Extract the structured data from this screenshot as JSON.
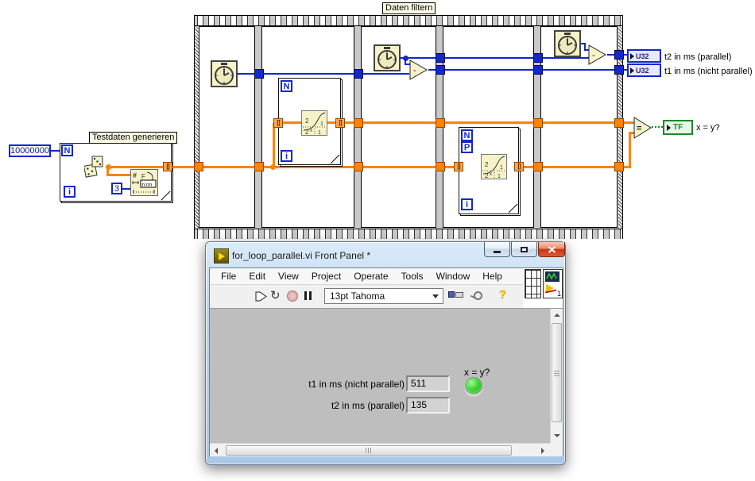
{
  "diagram": {
    "sequence_label": "Daten filtern",
    "loop1_label": "Testdaten generieren",
    "const_iterations": "10000000",
    "const_three": "3",
    "terminal_n": "N",
    "terminal_i": "i",
    "terminal_p": "P",
    "tunnel_brackets": "[]",
    "format_icon": {
      "hash": "#",
      "f": "F",
      "nnn": "n.nn"
    },
    "pow_icon": {
      "two": "2",
      "one_right": "1",
      "exp_base": "2",
      "exp_x": "x",
      "one_bottom": "1"
    },
    "subtract_glyph": "-",
    "equals_glyph": "=",
    "u32_text": "U32",
    "tf_text": "TF",
    "t2_label": "t2 in ms (parallel)",
    "t1_label": "t1 in ms (nicht parallel)",
    "xy_label": "x = y?"
  },
  "window": {
    "title": "for_loop_parallel.vi Front Panel *",
    "menu_items": [
      "File",
      "Edit",
      "View",
      "Project",
      "Operate",
      "Tools",
      "Window",
      "Help"
    ],
    "toolbar": {
      "font_selector": "13pt Tahoma",
      "run_continuous_glyph": "↻",
      "help_glyph": "?"
    },
    "vi_icon_number": "1",
    "panel": {
      "t1_label": "t1 in ms (nicht parallel)",
      "t1_value": "511",
      "t2_label": "t2 in ms (parallel)",
      "t2_value": "135",
      "led_label": "x = y?"
    }
  },
  "colors": {
    "wire_orange": "#FF8200",
    "wire_blue": "#1227CE",
    "node_beige": "#F7F3C8",
    "u32_blue": "#1227CE",
    "tf_green": "#1F8A25",
    "led_green": "#3FD52F",
    "panel_gray": "#BEBEBE",
    "close_button_red": "#C83518"
  }
}
